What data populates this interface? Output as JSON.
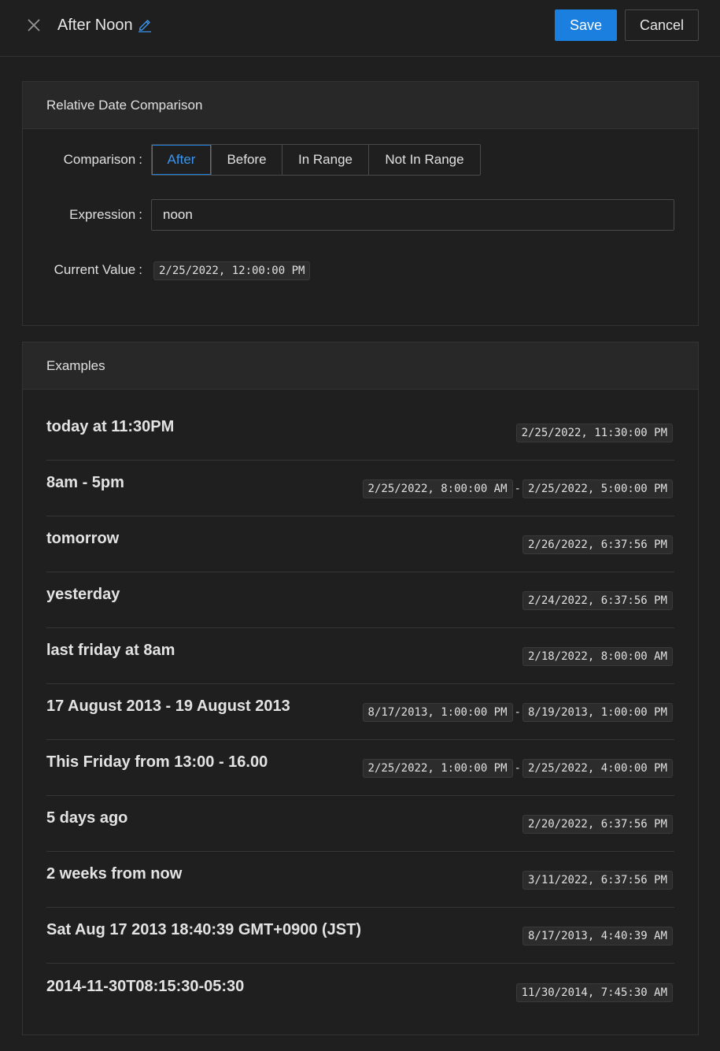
{
  "header": {
    "title": "After Noon",
    "save_label": "Save",
    "cancel_label": "Cancel"
  },
  "comparison_card": {
    "heading": "Relative Date Comparison",
    "comparison_label": "Comparison",
    "options": [
      "After",
      "Before",
      "In Range",
      "Not In Range"
    ],
    "selected_option": "After",
    "expression_label": "Expression",
    "expression_value": "noon",
    "current_value_label": "Current Value",
    "current_value": "2/25/2022, 12:00:00 PM"
  },
  "examples_card": {
    "heading": "Examples",
    "items": [
      {
        "expression": "today at 11:30PM",
        "values": [
          "2/25/2022, 11:30:00 PM"
        ]
      },
      {
        "expression": "8am - 5pm",
        "values": [
          "2/25/2022, 8:00:00 AM",
          "2/25/2022, 5:00:00 PM"
        ]
      },
      {
        "expression": "tomorrow",
        "values": [
          "2/26/2022, 6:37:56 PM"
        ]
      },
      {
        "expression": "yesterday",
        "values": [
          "2/24/2022, 6:37:56 PM"
        ]
      },
      {
        "expression": "last friday at 8am",
        "values": [
          "2/18/2022, 8:00:00 AM"
        ]
      },
      {
        "expression": "17 August 2013 - 19 August 2013",
        "values": [
          "8/17/2013, 1:00:00 PM",
          "8/19/2013, 1:00:00 PM"
        ]
      },
      {
        "expression": "This Friday from 13:00 - 16.00",
        "values": [
          "2/25/2022, 1:00:00 PM",
          "2/25/2022, 4:00:00 PM"
        ]
      },
      {
        "expression": "5 days ago",
        "values": [
          "2/20/2022, 6:37:56 PM"
        ]
      },
      {
        "expression": "2 weeks from now",
        "values": [
          "3/11/2022, 6:37:56 PM"
        ]
      },
      {
        "expression": "Sat Aug 17 2013 18:40:39 GMT+0900 (JST)",
        "values": [
          "8/17/2013, 4:40:39 AM"
        ]
      },
      {
        "expression": "2014-11-30T08:15:30-05:30",
        "values": [
          "11/30/2014, 7:45:30 AM"
        ]
      }
    ]
  },
  "colors": {
    "accent": "#1b7fe0",
    "background": "#1f1f1f",
    "card_header": "#282828"
  }
}
